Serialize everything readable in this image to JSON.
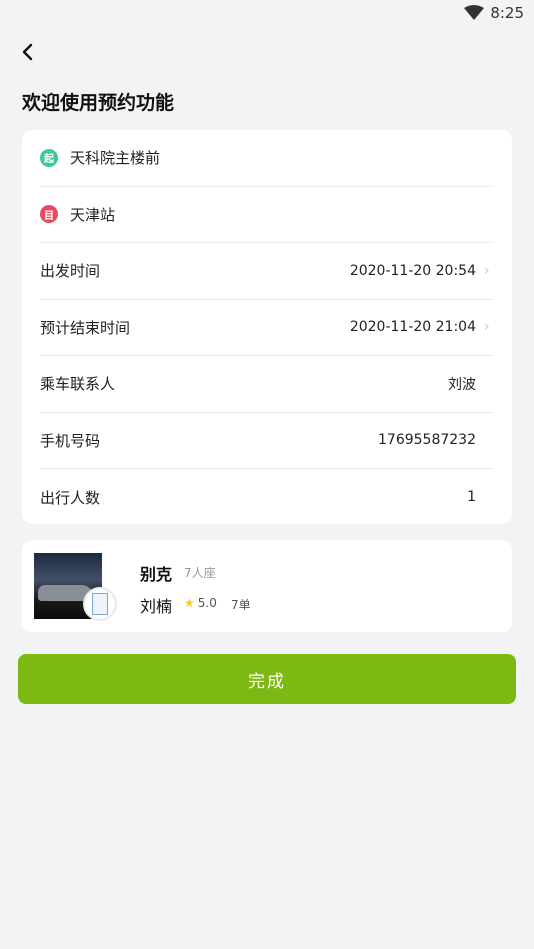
{
  "status_bar": {
    "time": "8:25",
    "wifi_icon": "wifi-icon"
  },
  "header": {
    "back_icon": "chevron-left-icon",
    "title": "欢迎使用预约功能"
  },
  "form": {
    "start": {
      "badge": "起",
      "badge_color": "#3dc89a",
      "text": "天科院主楼前"
    },
    "end": {
      "badge": "目",
      "badge_color": "#e84a5f",
      "text": "天津站"
    },
    "rows": [
      {
        "label": "出发时间",
        "value": "2020-11-20 20:54",
        "has_chevron": true
      },
      {
        "label": "预计结束时间",
        "value": "2020-11-20 21:04",
        "has_chevron": true
      },
      {
        "label": "乘车联系人",
        "value": "刘波",
        "has_chevron": false
      },
      {
        "label": "手机号码",
        "value": "17695587232",
        "has_chevron": false
      },
      {
        "label": "出行人数",
        "value": "1",
        "has_chevron": false
      }
    ]
  },
  "driver": {
    "car_name": "别克",
    "seats": "7人座",
    "driver_name": "刘楠",
    "rating": "5.0",
    "orders": "7单"
  },
  "actions": {
    "done_label": "完成",
    "accent": "#7eb913"
  }
}
